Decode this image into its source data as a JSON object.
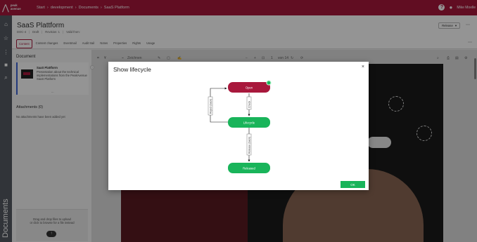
{
  "app": {
    "logo_line1": "peak",
    "logo_line2": "avenue",
    "breadcrumbs": [
      "Start",
      "development",
      "Documents",
      "SaaS Platform"
    ],
    "user_name": "Mike Moelle"
  },
  "document": {
    "title": "SaaS Plattform",
    "meta": [
      "DOC-4",
      "Draft",
      "Revision: 1",
      "Valid from:"
    ],
    "release_label": "Release",
    "tabs": [
      {
        "label": "Content",
        "active": true
      },
      {
        "label": "Content changes",
        "active": false
      },
      {
        "label": "Eventmail",
        "active": false
      },
      {
        "label": "Audit trail",
        "active": false
      },
      {
        "label": "Notes",
        "active": false
      },
      {
        "label": "Properties",
        "active": false
      },
      {
        "label": "Rights",
        "active": false
      },
      {
        "label": "Usage",
        "active": false
      }
    ]
  },
  "left_panel": {
    "title": "Document",
    "card_name": "SaaS Plattform",
    "card_description": "Presentation about the technical implementations from the PeakAvenue SaaS Platform",
    "card_more": "...",
    "attachments_title": "Attachments (0)",
    "no_attachments": "No attachments have been added yet",
    "dropzone_line1": "Drag and drop files to upload",
    "dropzone_line2": "or click to browse for a file instead",
    "vertical_label": "Documents"
  },
  "viewer": {
    "draw_label": "Zeichnen",
    "zoom_minus": "−",
    "zoom_plus": "+",
    "page_current": "1",
    "page_total": "von 14"
  },
  "modal": {
    "title": "Show lifecycle",
    "close": "×",
    "ok_label": "OK",
    "nodes": [
      {
        "label": "Open",
        "color": "#a8183c"
      },
      {
        "label": "Lifecycle",
        "color": "#19b45a"
      },
      {
        "label": "Released",
        "color": "#19b45a"
      }
    ],
    "edges": [
      "Check",
      "Reject (back)",
      "Release (back)"
    ]
  },
  "colors": {
    "brand": "#a8183c",
    "success": "#19b45a",
    "rail": "#555b63"
  }
}
